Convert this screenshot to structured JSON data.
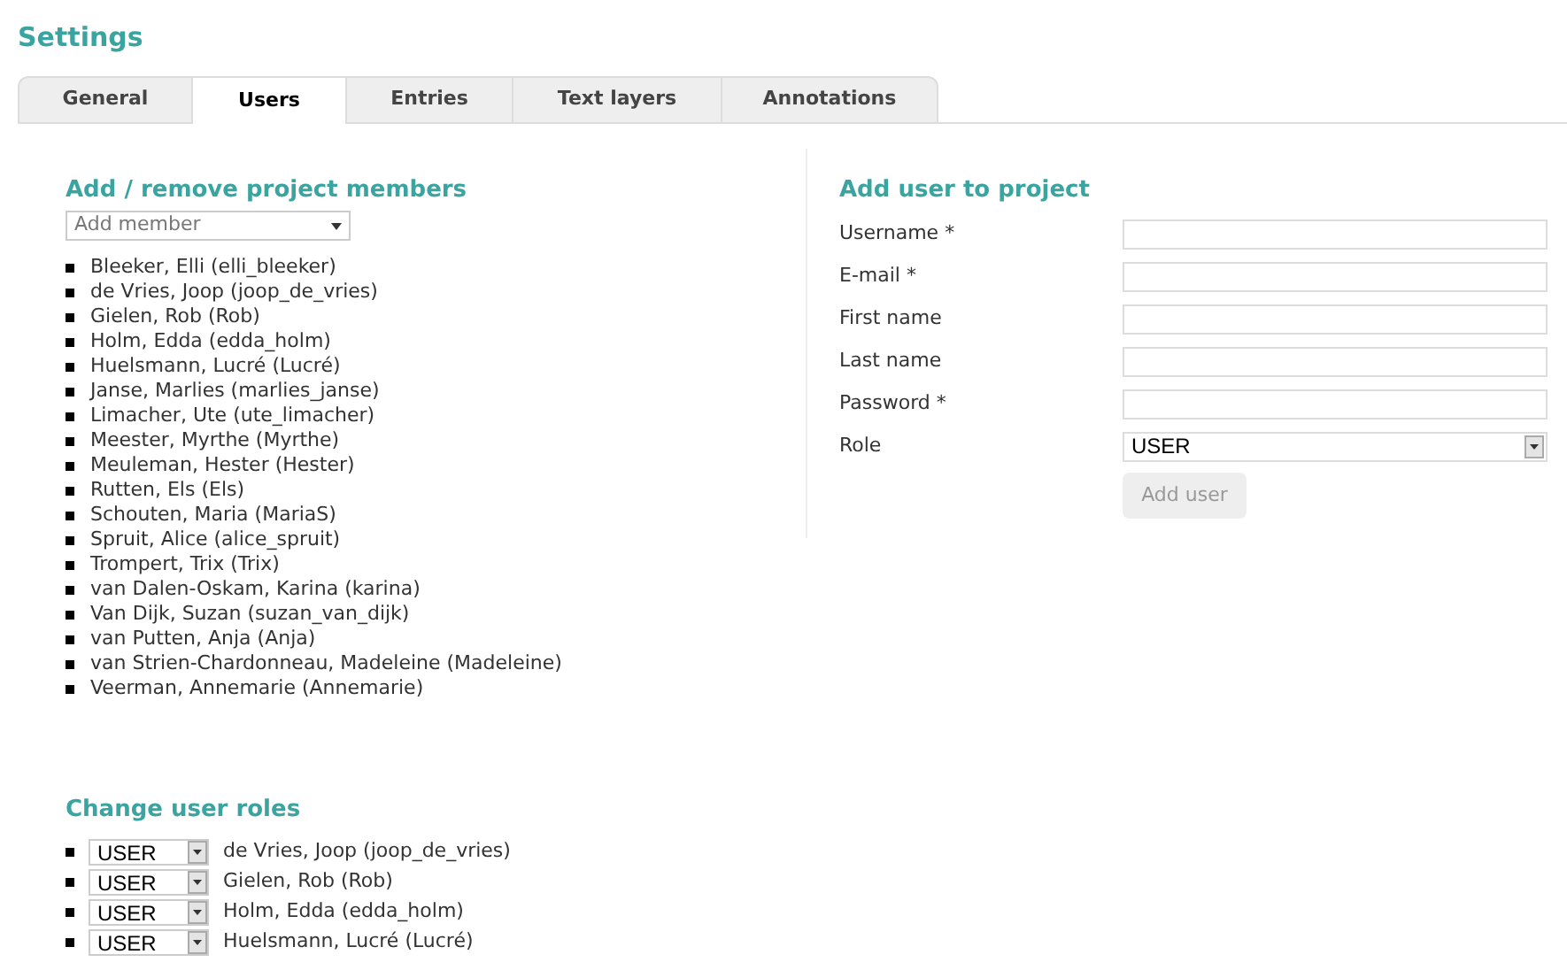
{
  "title": "Settings",
  "tabs": [
    {
      "label": "General",
      "selected": false
    },
    {
      "label": "Users",
      "selected": true
    },
    {
      "label": "Entries",
      "selected": false
    },
    {
      "label": "Text layers",
      "selected": false
    },
    {
      "label": "Annotations",
      "selected": false
    }
  ],
  "members": {
    "heading": "Add / remove project members",
    "add_member": {
      "placeholder": "Add member"
    },
    "items": [
      "Bleeker, Elli (elli_bleeker)",
      "de Vries, Joop (joop_de_vries)",
      "Gielen, Rob (Rob)",
      "Holm, Edda (edda_holm)",
      "Huelsmann, Lucré (Lucré)",
      "Janse, Marlies (marlies_janse)",
      "Limacher, Ute (ute_limacher)",
      "Meester, Myrthe (Myrthe)",
      "Meuleman, Hester (Hester)",
      "Rutten, Els (Els)",
      "Schouten, Maria (MariaS)",
      "Spruit, Alice (alice_spruit)",
      "Trompert, Trix (Trix)",
      "van Dalen-Oskam, Karina (karina)",
      "Van Dijk, Suzan (suzan_van_dijk)",
      "van Putten, Anja (Anja)",
      "van Strien-Chardonneau, Madeleine (Madeleine)",
      "Veerman, Annemarie (Annemarie)"
    ]
  },
  "add_user": {
    "heading": "Add user to project",
    "fields": [
      {
        "kind": "text",
        "label": "Username *"
      },
      {
        "kind": "text",
        "label": "E-mail *"
      },
      {
        "kind": "text",
        "label": "First name"
      },
      {
        "kind": "text",
        "label": "Last name"
      },
      {
        "kind": "text",
        "label": "Password *"
      },
      {
        "kind": "select",
        "label": "Role",
        "value": "USER"
      }
    ],
    "button": {
      "label": "Add user",
      "disabled": true
    }
  },
  "roles": {
    "heading": "Change user roles",
    "rows": [
      {
        "role": "USER",
        "name": "de Vries, Joop (joop_de_vries)"
      },
      {
        "role": "USER",
        "name": "Gielen, Rob (Rob)"
      },
      {
        "role": "USER",
        "name": "Holm, Edda (edda_holm)"
      },
      {
        "role": "USER",
        "name": "Huelsmann, Lucré (Lucré)"
      }
    ]
  }
}
